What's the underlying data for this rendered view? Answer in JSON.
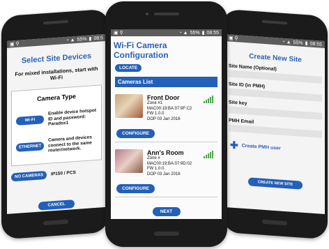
{
  "left_phone": {
    "status_time": "08:5",
    "status_battery": "55%",
    "title": "Select Site Devices",
    "subtitle": "For mixed installations, start with Wi-Fi",
    "camera_type_title": "Camera Type",
    "wifi_button": "Wi-Fi",
    "wifi_desc": "Enable device hotspot ID and password: Paradox1",
    "ethernet_button": "ETHERNET",
    "ethernet_desc": "Camera and devices connect to the same router/network.",
    "no_cameras_button": "NO CAMERAS",
    "no_cameras_desc": "IP150 / PCS",
    "cancel_button": "CANCEL"
  },
  "center_phone": {
    "status_time": "08:55",
    "status_battery": "55%",
    "title": "Wi-Fi Camera Configuration",
    "locate_button": "LOCATE",
    "cameras_list_header": "Cameras List",
    "cameras": [
      {
        "name": "Front Door",
        "zone": "Zone #1",
        "mac": "MAC00:19:BA:07:9F:C2",
        "fw": "FW 1.0.0",
        "dop": "DOP 03 Jan 2016",
        "configure_label": "CONFIGURE"
      },
      {
        "name": "Ann's Room",
        "zone": "Zone #",
        "mac": "MAC00:19:BA:07:9D:02",
        "fw": "FW 1.0.0",
        "dop": "DOP 03 Jan 2016",
        "configure_label": "CONFIGURE"
      }
    ],
    "next_button": "NEXT"
  },
  "right_phone": {
    "status_time": "08:55",
    "status_battery": "55%",
    "title": "Create New Site",
    "site_name_label": "Site Name (Optional)",
    "site_id_label": "Site ID (in PMH)",
    "site_key_label": "Site key",
    "pmh_email_label": "PMH Email",
    "create_pmh_user_label": "Create PMH user",
    "create_site_button": "CREATE NEW SITE"
  },
  "colors": {
    "accent": "#2360b8",
    "title_blue": "#2a62b6",
    "signal_green": "#4ca64c"
  }
}
